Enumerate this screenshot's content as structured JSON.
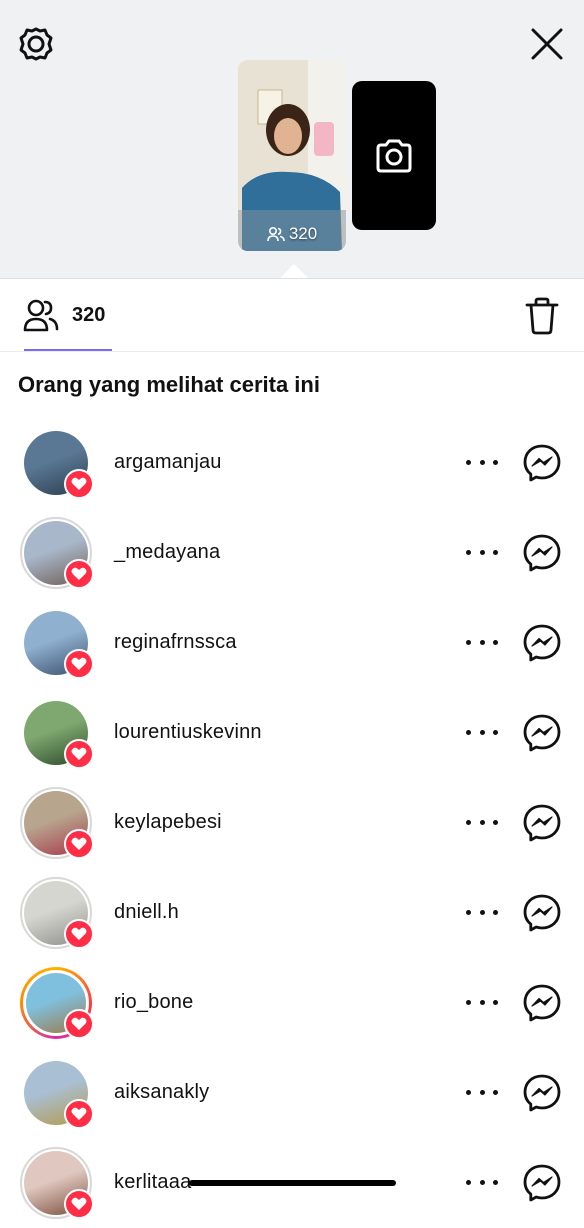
{
  "story": {
    "viewer_count": "320"
  },
  "tabs": {
    "viewers_count": "320"
  },
  "section_title": "Orang yang melihat cerita ini",
  "viewers": [
    {
      "username": "argamanjau",
      "ring": "none",
      "avatar_colors": [
        "#5a7894",
        "#2c3e50"
      ]
    },
    {
      "username": "_medayana",
      "ring": "gray",
      "avatar_colors": [
        "#a8b7c9",
        "#6f5e57"
      ]
    },
    {
      "username": "reginafrnssca",
      "ring": "none",
      "avatar_colors": [
        "#8fb0cf",
        "#3c4f6e"
      ]
    },
    {
      "username": "lourentiuskevinn",
      "ring": "none",
      "avatar_colors": [
        "#7fa870",
        "#2d4a2a"
      ]
    },
    {
      "username": "keylapebesi",
      "ring": "gray",
      "avatar_colors": [
        "#b7a58e",
        "#a83a4b"
      ]
    },
    {
      "username": "dniell.h",
      "ring": "gray",
      "avatar_colors": [
        "#d6d6d0",
        "#8d8f8a"
      ]
    },
    {
      "username": "rio_bone",
      "ring": "gradient",
      "avatar_colors": [
        "#7fc0df",
        "#9b7a4a"
      ]
    },
    {
      "username": "aiksanakly",
      "ring": "none",
      "avatar_colors": [
        "#a9bfd3",
        "#b49a4a"
      ]
    },
    {
      "username": "kerlitaaa",
      "ring": "gray",
      "avatar_colors": [
        "#e0c8c0",
        "#7a4e3c"
      ]
    }
  ],
  "colors": {
    "heart": "#ff2d46",
    "tab_underline": "#7c6cf2",
    "header_bg": "#eff1f3"
  },
  "icons": {
    "settings": "gear-icon",
    "close": "close-icon",
    "camera": "camera-icon",
    "viewers": "people-icon",
    "delete": "trash-icon",
    "more": "more-icon",
    "message": "messenger-icon",
    "like": "heart-icon"
  }
}
